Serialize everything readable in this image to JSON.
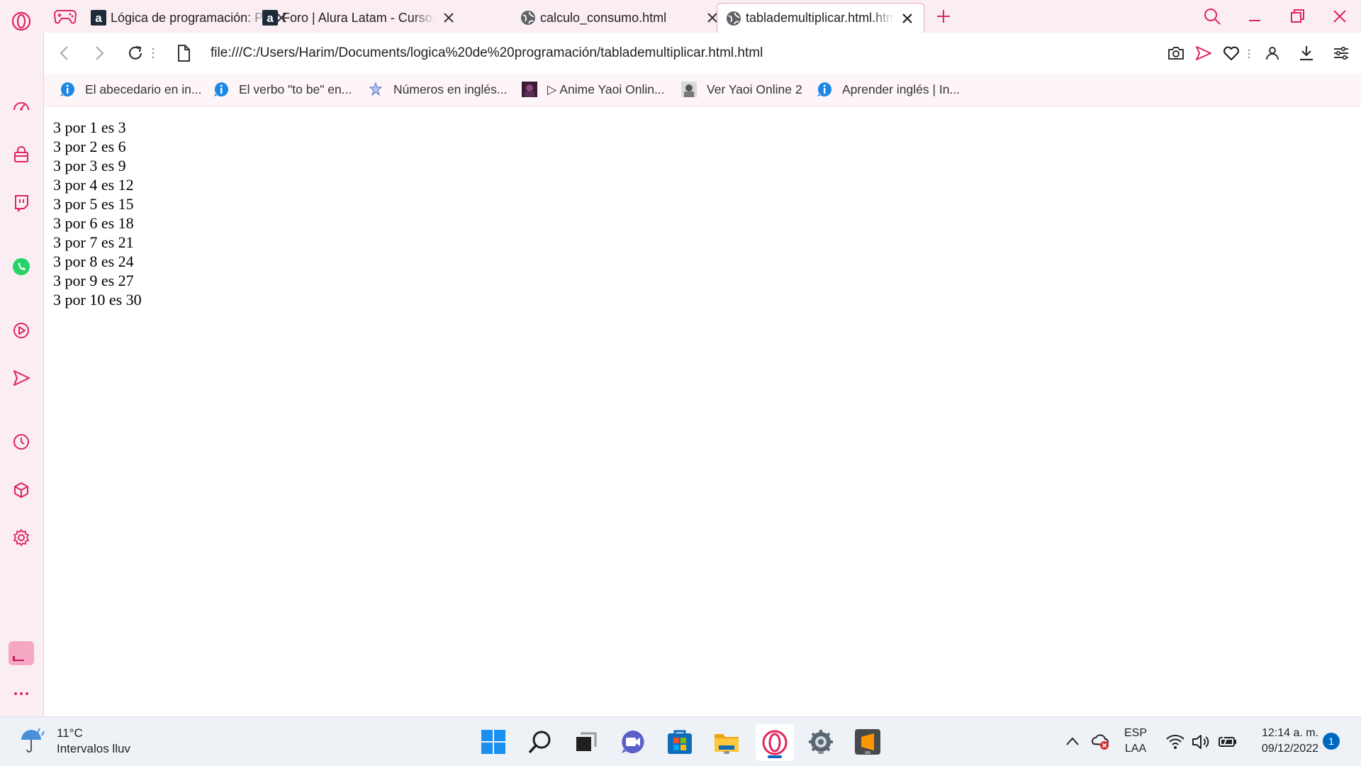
{
  "tabs": [
    {
      "title": "Lógica de programación: Primeros pasos",
      "favicon": "alura-icon"
    },
    {
      "title": "Foro | Alura Latam - Cursos online",
      "favicon": "alura-icon"
    },
    {
      "title": "calculo_consumo.html",
      "favicon": "globe-icon"
    },
    {
      "title": "tablademultiplicar.html.html",
      "favicon": "globe-icon",
      "active": true
    }
  ],
  "address_bar": {
    "url": "file:///C:/Users/Harim/Documents/logica%20de%20programación/tablademultiplicar.html.html"
  },
  "bookmarks": [
    {
      "label": "El abecedario en in...",
      "icon": "info-icon"
    },
    {
      "label": "El verbo \"to be\" en...",
      "icon": "info-icon"
    },
    {
      "label": "Números en inglés...",
      "icon": "star-figure-icon"
    },
    {
      "label": "▷ Anime Yaoi Onlin...",
      "icon": "anime-thumb-icon"
    },
    {
      "label": "Ver Yaoi Online 2",
      "icon": "anime-thumb-icon"
    },
    {
      "label": "Aprender inglés | In...",
      "icon": "info-icon"
    }
  ],
  "page": {
    "lines": [
      "3 por 1 es 3",
      "3 por 2 es 6",
      "3 por 3 es 9",
      "3 por 4 es 12",
      "3 por 5 es 15",
      "3 por 6 es 18",
      "3 por 7 es 21",
      "3 por 8 es 24",
      "3 por 9 es 27",
      "3 por 10 es 30"
    ]
  },
  "taskbar": {
    "weather_temp": "11°C",
    "weather_desc": "Intervalos lluv",
    "language": "ESP",
    "layout": "LAA",
    "time": "12:14 a. m.",
    "date": "09/12/2022",
    "notifications": "1"
  },
  "colors": {
    "accent": "#e0245e",
    "chrome_bg": "#fbeef3",
    "taskbar_bg": "#eef2f7"
  }
}
